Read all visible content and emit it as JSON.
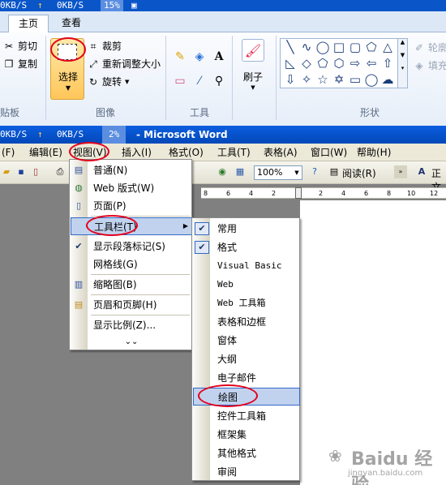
{
  "paint": {
    "title_segments": [
      "0KB/S",
      "0KB/S",
      "15%"
    ],
    "tabs": [
      "主页",
      "查看"
    ],
    "clipboard": {
      "cut": "剪切",
      "copy": "复制",
      "label": "贴板"
    },
    "image": {
      "select": "选择",
      "crop": "裁剪",
      "resize": "重新调整大小",
      "rotate": "旋转",
      "label": "图像"
    },
    "tools": {
      "label": "工具"
    },
    "brush": "刷子",
    "shapes": {
      "label": "形状",
      "outline": "轮廓",
      "fill": "填充"
    }
  },
  "word": {
    "title_segments": [
      "0KB/S",
      "0KB/S",
      "2%"
    ],
    "title": "- Microsoft Word",
    "menubar": [
      "(F)",
      "编辑(E)",
      "视图(V)",
      "插入(I)",
      "格式(O)",
      "工具(T)",
      "表格(A)",
      "窗口(W)",
      "帮助(H)"
    ],
    "zoom": "100%",
    "read_button": "阅读(R)",
    "font_label": "正文",
    "ruler_ticks": [
      "8",
      "6",
      "4",
      "2",
      "2",
      "4",
      "6",
      "8",
      "10",
      "12"
    ],
    "view_menu": [
      {
        "label": "普通(N)",
        "icon": "normal-view-icon"
      },
      {
        "label": "Web 版式(W)",
        "icon": "web-layout-icon"
      },
      {
        "label": "页面(P)",
        "icon": "page-layout-icon"
      },
      {
        "label": "工具栏(T)",
        "icon": "",
        "submenu": true
      },
      {
        "label": "显示段落标记(S)",
        "icon": "checkmark-icon"
      },
      {
        "label": "网格线(G)",
        "icon": ""
      },
      {
        "label": "缩略图(B)",
        "icon": "thumbnail-icon"
      },
      {
        "label": "页眉和页脚(H)",
        "icon": "header-footer-icon"
      },
      {
        "label": "显示比例(Z)...",
        "icon": ""
      }
    ],
    "toolbars_submenu": [
      {
        "label": "常用",
        "checked": true
      },
      {
        "label": "格式",
        "checked": true
      },
      {
        "label": "Visual Basic",
        "checked": false
      },
      {
        "label": "Web",
        "checked": false
      },
      {
        "label": "Web 工具箱",
        "checked": false
      },
      {
        "label": "表格和边框",
        "checked": false
      },
      {
        "label": "窗体",
        "checked": false
      },
      {
        "label": "大纲",
        "checked": false
      },
      {
        "label": "电子邮件",
        "checked": false
      },
      {
        "label": "绘图",
        "checked": false,
        "highlighted": true
      },
      {
        "label": "控件工具箱",
        "checked": false
      },
      {
        "label": "框架集",
        "checked": false
      },
      {
        "label": "其他格式",
        "checked": false
      },
      {
        "label": "审阅",
        "checked": false
      }
    ]
  },
  "watermark": {
    "brand": "Baidu 经验",
    "url": "jingyan.baidu.com"
  }
}
